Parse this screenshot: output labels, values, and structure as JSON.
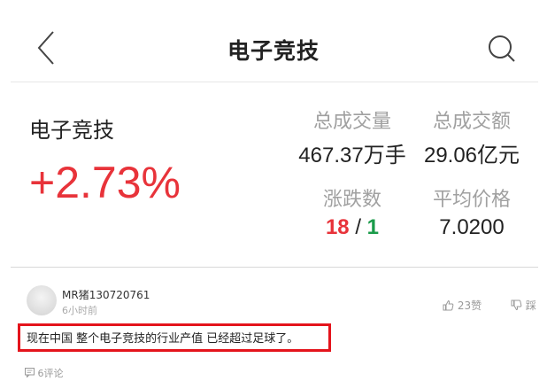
{
  "nav": {
    "title": "电子竞技",
    "back_icon": "chevron-left-icon",
    "search_icon": "search-icon"
  },
  "summary": {
    "sector_name": "电子竞技",
    "change_percent": "+2.73%",
    "total_volume_label": "总成交量",
    "total_volume_value": "467.37万手",
    "total_amount_label": "总成交额",
    "total_amount_value": "29.06亿元",
    "up_down_label": "涨跌数",
    "up_count": "18",
    "separator": " / ",
    "down_count": "1",
    "avg_price_label": "平均价格",
    "avg_price_value": "7.0200",
    "colors": {
      "up": "#e8333a",
      "down": "#1a9b4a",
      "muted": "#a0a0a0"
    }
  },
  "comment": {
    "username": "MR猪130720761",
    "time_ago": "6小时前",
    "like_icon": "thumbs-up-icon",
    "like_label": "23赞",
    "dislike_icon": "thumbs-down-icon",
    "dislike_label": "踩",
    "text": "现在中国 整个电子竞技的行业产值 已经超过足球了。",
    "reply_icon": "comment-icon",
    "reply_label": "6评论",
    "highlight_color": "#e4141c"
  }
}
